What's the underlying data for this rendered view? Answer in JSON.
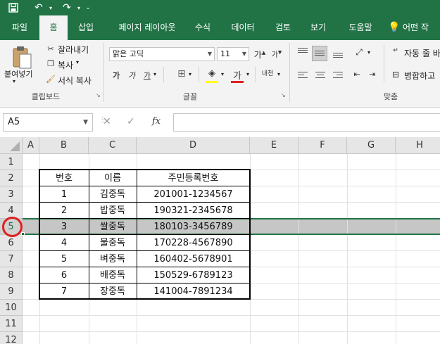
{
  "quick_access": {
    "save_icon": "save-icon",
    "undo_icon": "undo-icon",
    "redo_icon": "redo-icon",
    "customize_icon": "customize-icon"
  },
  "tabs": [
    "파일",
    "홈",
    "삽입",
    "페이지 레이아웃",
    "수식",
    "데이터",
    "검토",
    "보기",
    "도움말"
  ],
  "tell_me": "어떤 작",
  "clipboard": {
    "paste": "붙여넣기",
    "cut": "잘라내기",
    "copy": "복사",
    "format_painter": "서식 복사",
    "label": "클립보드"
  },
  "font": {
    "name": "맑은 고딕",
    "size": "11",
    "label": "글꼴",
    "bold": "가",
    "italic": "가",
    "underline": "가",
    "font_color": "가",
    "phonetic": "내천"
  },
  "alignment": {
    "wrap": "자동 줄 바",
    "merge": "병합하고",
    "label": "맞춤"
  },
  "name_box": "A5",
  "formula_value": "",
  "columns": [
    "A",
    "B",
    "C",
    "D",
    "E",
    "F",
    "G",
    "H"
  ],
  "rows": [
    "1",
    "2",
    "3",
    "4",
    "5",
    "6",
    "7",
    "8",
    "9",
    "10",
    "11",
    "12"
  ],
  "table": {
    "headers": [
      "번호",
      "이름",
      "주민등록번호"
    ],
    "rows": [
      [
        "1",
        "김중독",
        "201001-1234567"
      ],
      [
        "2",
        "밥중독",
        "190321-2345678"
      ],
      [
        "3",
        "쌀중독",
        "180103-3456789"
      ],
      [
        "4",
        "물중독",
        "170228-4567890"
      ],
      [
        "5",
        "벼중독",
        "160402-5678901"
      ],
      [
        "6",
        "배중독",
        "150529-6789123"
      ],
      [
        "7",
        "장중독",
        "141004-7891234"
      ]
    ]
  },
  "colors": {
    "accent": "#217346",
    "selection": "#c6c6c6",
    "highlight_circle": "#e02020"
  }
}
